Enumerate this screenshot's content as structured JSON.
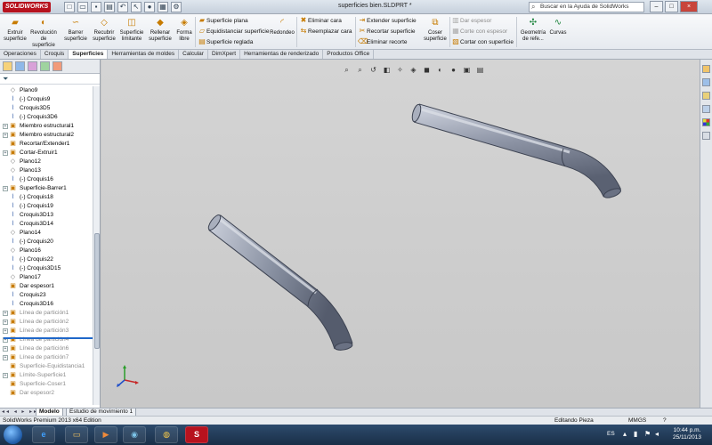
{
  "window": {
    "app_logo": "SOLIDWORKS",
    "document_title": "superficies bien.SLDPRT *",
    "help_search_placeholder": "Buscar en la Ayuda de SolidWorks",
    "controls": [
      "–",
      "□",
      "×"
    ]
  },
  "ribbon": {
    "large_buttons": [
      {
        "label": "Extruir superficie",
        "icon": "extrude-surface-icon"
      },
      {
        "label": "Revolución de superficie",
        "icon": "revolve-surface-icon"
      },
      {
        "label": "Barrer superficie",
        "icon": "sweep-surface-icon"
      },
      {
        "label": "Recubrir superficie",
        "icon": "loft-surface-icon"
      },
      {
        "label": "Superficie limitante",
        "icon": "boundary-surface-icon"
      },
      {
        "label": "Rellenar superficie",
        "icon": "fill-surface-icon"
      },
      {
        "label": "Forma libre",
        "icon": "freeform-icon"
      }
    ],
    "group1": [
      "Superficie plana",
      "Equidistanciar superficie",
      "Superficie reglada"
    ],
    "redondeo": "Redondeo",
    "group2": [
      "Eliminar cara",
      "Reemplazar cara"
    ],
    "group3": [
      "Extender superficie",
      "Recortar superficie",
      "Eliminar recorte"
    ],
    "coser": "Coser superficie",
    "group4": [
      "Dar espesor",
      "Corte con espesor",
      "Cortar con superficie"
    ],
    "geometria": "Geometría de refe...",
    "curvas": "Curvas"
  },
  "tabs": [
    "Operaciones",
    "Croquis",
    "Superficies",
    "Herramientas de moldes",
    "Calcular",
    "DimXpert",
    "Herramientas de renderizado",
    "Productos Office"
  ],
  "active_tab": "Superficies",
  "tree": [
    {
      "label": "Plano9",
      "type": "plane",
      "exp": ""
    },
    {
      "label": "(-) Croquis9",
      "type": "sketch",
      "exp": ""
    },
    {
      "label": "Croquis3D5",
      "type": "sketch",
      "exp": ""
    },
    {
      "label": "(-) Croquis3D6",
      "type": "sketch",
      "exp": ""
    },
    {
      "label": "Miembro estructural1",
      "type": "feat",
      "exp": "+"
    },
    {
      "label": "Miembro estructural2",
      "type": "feat",
      "exp": "+"
    },
    {
      "label": "Recortar/Extender1",
      "type": "feat",
      "exp": ""
    },
    {
      "label": "Cortar-Extruir1",
      "type": "feat",
      "exp": "+"
    },
    {
      "label": "Plano12",
      "type": "plane",
      "exp": ""
    },
    {
      "label": "Plano13",
      "type": "plane",
      "exp": ""
    },
    {
      "label": "(-) Croquis16",
      "type": "sketch",
      "exp": ""
    },
    {
      "label": "Superficie-Barrer1",
      "type": "feat",
      "exp": "+"
    },
    {
      "label": "(-) Croquis18",
      "type": "sketch",
      "exp": ""
    },
    {
      "label": "(-) Croquis19",
      "type": "sketch",
      "exp": ""
    },
    {
      "label": "Croquis3D13",
      "type": "sketch",
      "exp": ""
    },
    {
      "label": "Croquis3D14",
      "type": "sketch",
      "exp": ""
    },
    {
      "label": "Plano14",
      "type": "plane",
      "exp": ""
    },
    {
      "label": "(-) Croquis20",
      "type": "sketch",
      "exp": ""
    },
    {
      "label": "Plano16",
      "type": "plane",
      "exp": ""
    },
    {
      "label": "(-) Croquis22",
      "type": "sketch",
      "exp": ""
    },
    {
      "label": "(-) Croquis3D15",
      "type": "sketch",
      "exp": ""
    },
    {
      "label": "Plano17",
      "type": "plane",
      "exp": ""
    },
    {
      "label": "Dar espesor1",
      "type": "feat",
      "exp": ""
    },
    {
      "label": "Croquis23",
      "type": "sketch",
      "exp": ""
    },
    {
      "label": "Croquis3D16",
      "type": "sketch",
      "exp": ""
    },
    {
      "label": "Línea de partición1",
      "type": "feat",
      "exp": "+",
      "suppressed": true
    },
    {
      "label": "Línea de partición2",
      "type": "feat",
      "exp": "+",
      "suppressed": true
    },
    {
      "label": "Línea de partición3",
      "type": "feat",
      "exp": "+",
      "suppressed": true
    },
    {
      "label": "Línea de partición4",
      "type": "feat",
      "exp": "+",
      "suppressed": true
    },
    {
      "label": "Línea de partición6",
      "type": "feat",
      "exp": "+",
      "suppressed": true
    },
    {
      "label": "Línea de partición7",
      "type": "feat",
      "exp": "+",
      "suppressed": true
    },
    {
      "label": "Superficie-Equidistancia1",
      "type": "feat",
      "exp": "",
      "suppressed": true
    },
    {
      "label": "Límite-Superficie1",
      "type": "feat",
      "exp": "+",
      "suppressed": true
    },
    {
      "label": "Superficie-Coser1",
      "type": "feat",
      "exp": "",
      "suppressed": true
    },
    {
      "label": "Dar espesor2",
      "type": "feat",
      "exp": "",
      "suppressed": true
    }
  ],
  "model_tabs": [
    "Modelo",
    "Estudio de movimiento 1"
  ],
  "model_nav": "◂◂ ◂ ▸ ▸▸",
  "status": {
    "edition": "SolidWorks Premium 2013 x64 Edition",
    "mode": "Editando Pieza",
    "units": "MMGS",
    "help": "?"
  },
  "taskbar": {
    "lang": "ES",
    "time": "10:44 p.m.",
    "date": "25/11/2013"
  },
  "colors": {
    "accent": "#1f67c9",
    "logo": "#b7121e",
    "part": "#7d8596"
  }
}
